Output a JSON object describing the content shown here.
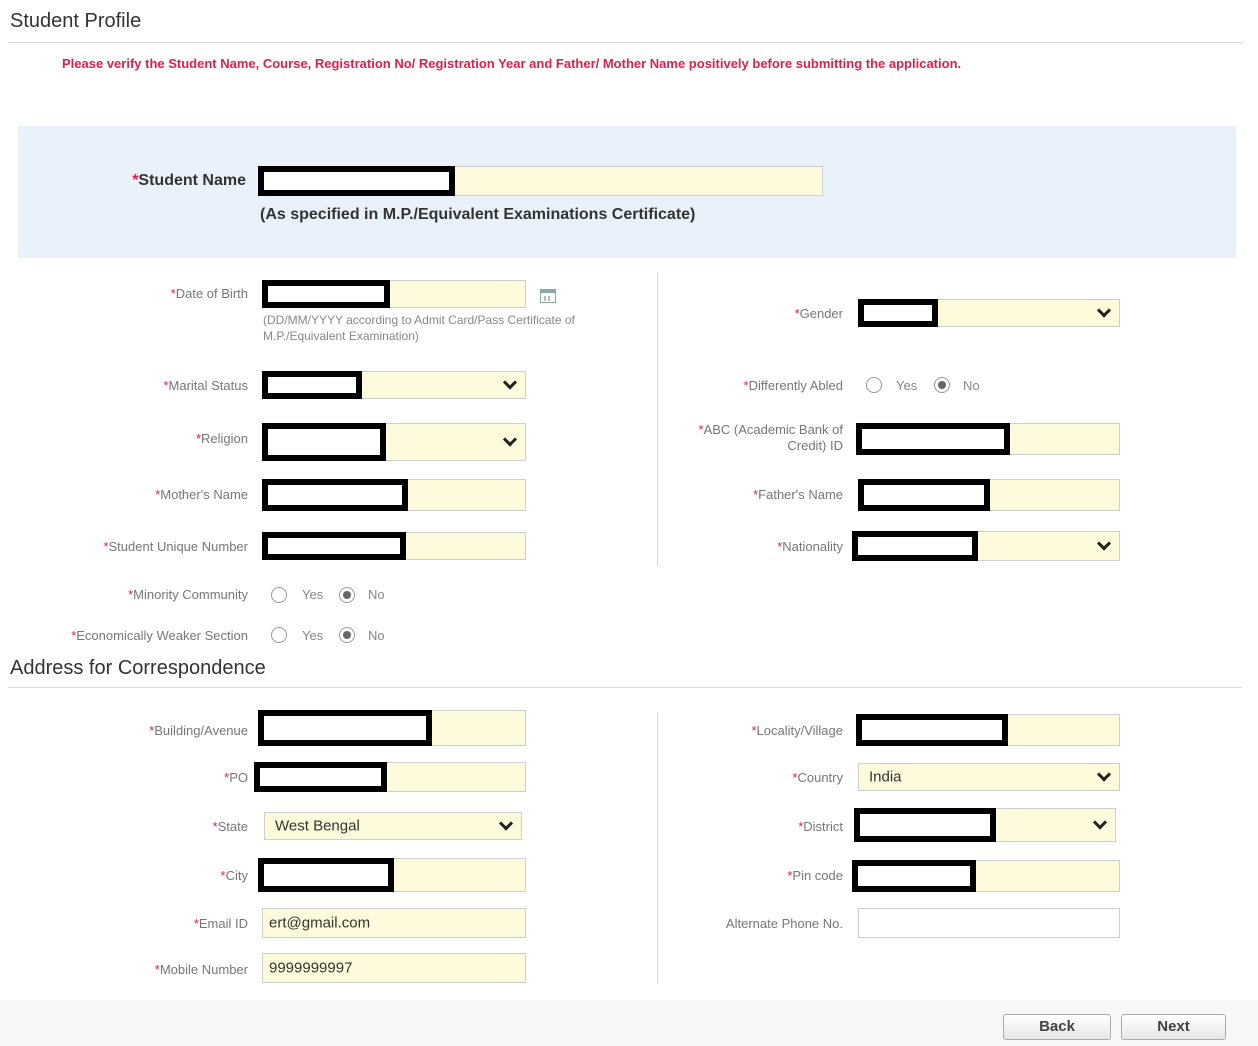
{
  "page": {
    "title": "Student Profile",
    "notice": "Please verify the Student Name, Course, Registration No/ Registration Year and Father/ Mother Name positively before submitting the application."
  },
  "student_name": {
    "label": "Student Name",
    "hint": "(As specified in M.P./Equivalent Examinations Certificate)"
  },
  "profile": {
    "dob_label": "Date of Birth",
    "dob_hint": "(DD/MM/YYYY according to Admit Card/Pass Certificate of M.P./Equivalent Examination)",
    "gender_label": "Gender",
    "marital_label": "Marital Status",
    "differently_abled_label": "Differently Abled",
    "religion_label": "Religion",
    "abc_label": "ABC (Academic Bank of Credit) ID",
    "mother_label": "Mother's Name",
    "father_label": "Father's Name",
    "sun_label": "Student Unique Number",
    "nationality_label": "Nationality",
    "minority_label": "Minority Community",
    "ews_label": "Economically Weaker Section",
    "yes": "Yes",
    "no": "No",
    "differently_abled_value": "No",
    "minority_value": "No",
    "ews_value": "No"
  },
  "address": {
    "title": "Address for Correspondence",
    "building_label": "Building/Avenue",
    "locality_label": "Locality/Village",
    "po_label": "PO",
    "country_label": "Country",
    "country_value": "India",
    "state_label": "State",
    "state_value": "West Bengal",
    "district_label": "District",
    "city_label": "City",
    "pin_label": "Pin code",
    "email_label": "Email ID",
    "email_value": "ert@gmail.com",
    "alt_phone_label": "Alternate Phone No.",
    "mobile_label": "Mobile Number",
    "mobile_value": "9999999997"
  },
  "buttons": {
    "back": "Back",
    "next": "Next"
  }
}
